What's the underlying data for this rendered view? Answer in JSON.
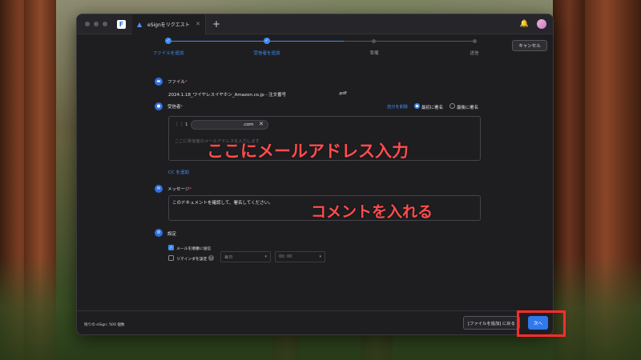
{
  "window": {
    "tab_label": "eSignをリクエスト",
    "tab_icon": "esign-icon",
    "new_tab_label": "+"
  },
  "stepper": {
    "steps": [
      {
        "label": "ファイルを追加",
        "state": "done"
      },
      {
        "label": "受信者を追加",
        "state": "active"
      },
      {
        "label": "準備",
        "state": "pending"
      },
      {
        "label": "送信",
        "state": "pending"
      }
    ],
    "cancel_label": "キャンセル"
  },
  "file_section": {
    "label": "ファイル",
    "required_mark": "*",
    "file_name": "2024.1.18_ワイヤレスイヤホン_Amazon.co.jp - 注文番号",
    "file_ext": ".pdf"
  },
  "recipient_section": {
    "label": "受信者",
    "required_mark": "*",
    "delete_self_link": "自分を削除",
    "options": [
      {
        "label": "最初に署名",
        "selected": true
      },
      {
        "label": "最後に署名",
        "selected": false
      }
    ],
    "handle_glyph": "⋮⋮",
    "recipient_number": "1",
    "recipient_email": ".com",
    "remove_glyph": "✕",
    "placeholder": "ここに受信者のメールアドレスを入力します",
    "cc_link": "CC を追加"
  },
  "message_section": {
    "label": "メッセージ",
    "required_mark": "*",
    "message_text": "このドキュメントを確認して、署名してください。"
  },
  "settings_section": {
    "label": "設定",
    "send_email_label": "メールを順番に送信",
    "send_email_checked": true,
    "reminder_label": "リマインダを設定",
    "reminder_checked": false,
    "help_glyph": "?",
    "frequency_value": "毎日",
    "time_value": "00: 00"
  },
  "footer": {
    "remaining_text": "残りの eSign: 500 個数",
    "back_label": "[ファイルを追加] に戻る",
    "next_label": "次へ"
  },
  "annotations": {
    "email_note": "ここにメールアドレス入力",
    "comment_note": "コメントを入れる",
    "color": "#ff4d4d"
  },
  "colors": {
    "accent": "#3f8cf4",
    "window_bg": "#1e1e21"
  }
}
